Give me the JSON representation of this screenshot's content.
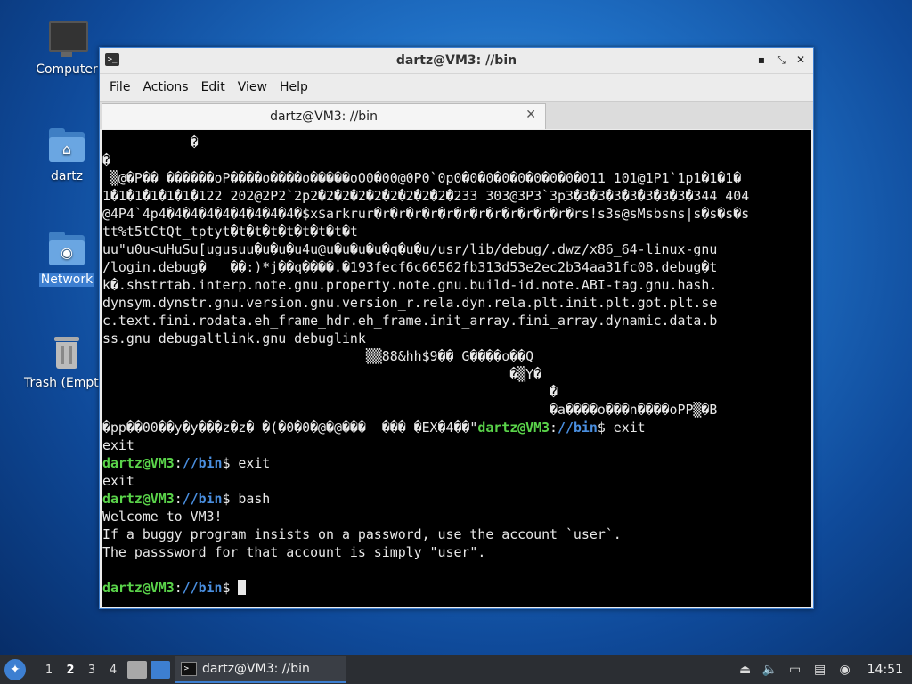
{
  "desktop": {
    "icons": [
      {
        "label": "Computer"
      },
      {
        "label": "dartz"
      },
      {
        "label": "Network"
      },
      {
        "label": "Trash (Empty)"
      }
    ]
  },
  "window": {
    "title": "dartz@VM3: //bin",
    "titlebar_icon": ">_",
    "minimize": "▪",
    "maximize": "⤡",
    "close": "✕",
    "menu": [
      "File",
      "Actions",
      "Edit",
      "View",
      "Help"
    ],
    "tab": {
      "label": "dartz@VM3: //bin",
      "close": "✕"
    }
  },
  "terminal": {
    "prompt_user": "dartz@VM3",
    "prompt_path": "//bin",
    "binary_lines": [
      "           �",
      "�",
      " ▒@�P�� ������oP����o����o�����oO0�00@0P0`0p0�0�0�0�0�0�0�0�011 101@1P1`1p1�1�1�",
      "1�1�1�1�1�1�122 202@2P2`2p2�2�2�2�2�2�2�2�2�233 303@3P3`3p3�3�3�3�3�3�3�3�344 404",
      "@4P4`4p4�4�4�4�4�4�4�4�4�$x$arkrur�r�r�r�r�r�r�r�r�r�r�r�r�rs!s3s@sMsbsns|s�s�s�s",
      "tt%t5tCtQt_tptyt�t�t�t�t�t�t�t�t",
      "uu\"u0u<uHuSu[ugusuu�u�u�u4u@u�u�u�u�q�u�u/usr/lib/debug/.dwz/x86_64-linux-gnu",
      "/login.debug�   ��:)*j��q����.�193fecf6c66562fb313d53e2ec2b34aa31fc08.debug�t",
      "k�.shstrtab.interp.note.gnu.property.note.gnu.build-id.note.ABI-tag.gnu.hash.",
      "dynsym.dynstr.gnu.version.gnu.version_r.rela.dyn.rela.plt.init.plt.got.plt.se",
      "c.text.fini.rodata.eh_frame_hdr.eh_frame.init_array.fini_array.dynamic.data.b",
      "ss.gnu_debugaltlink.gnu_debuglink",
      "                                 ▒▒88&hh$9�� G����o��Q",
      "                                                   �▒Y�",
      "                                                        �",
      "                                                        �a����o���n����oPP▒�B"
    ],
    "garbled_before_prompt": "�pp��00��y�y���z�z� �(�0�0�@�@���  ��� �EX�4��\"",
    "cmd1": "$ exit",
    "out1": "exit",
    "cmd2": "$ exit",
    "out2": "exit",
    "cmd3": "$ bash",
    "welcome": [
      "Welcome to VM3!",
      "If a buggy program insists on a password, use the account `user`.",
      "The passsword for that account is simply \"user\"."
    ],
    "final_prompt_suffix": "$ "
  },
  "taskbar": {
    "workspaces": [
      "1",
      "2",
      "3",
      "4"
    ],
    "active_workspace": "2",
    "task_label": "dartz@VM3: //bin",
    "clock": "14:51"
  },
  "colors": {
    "accent": "#3d7fd1",
    "prompt_user": "#5ad44a",
    "prompt_path": "#4a8fe0",
    "terminal_bg": "#000000",
    "taskbar_bg": "#2b2e33"
  }
}
